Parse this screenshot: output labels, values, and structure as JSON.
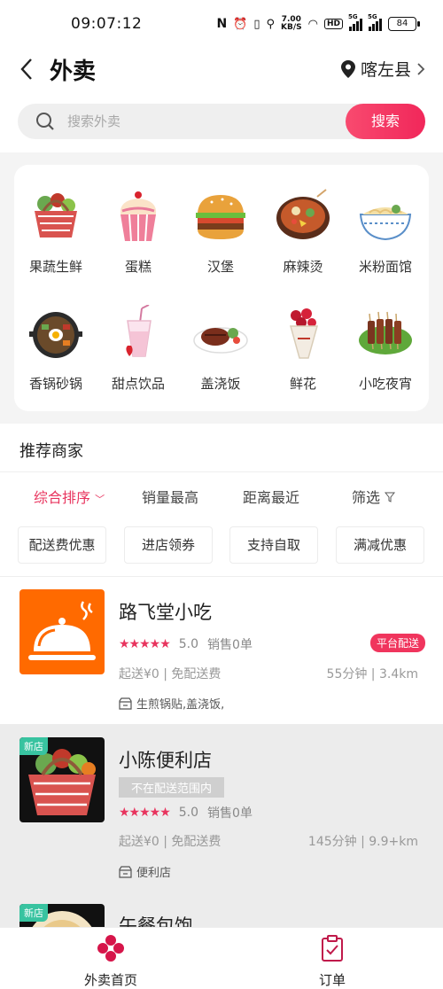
{
  "status_bar": {
    "time": "09:07:12",
    "speed": "7.00",
    "speed_unit": "KB/S",
    "hd": "HD",
    "net1": "5G",
    "net2": "5G",
    "battery": "84"
  },
  "header": {
    "title": "外卖",
    "location": "喀左县"
  },
  "search": {
    "placeholder": "搜索外卖",
    "button": "搜索"
  },
  "categories": [
    {
      "label": "果蔬生鲜",
      "icon": "vegetable-basket-icon"
    },
    {
      "label": "蛋糕",
      "icon": "cupcake-icon"
    },
    {
      "label": "汉堡",
      "icon": "burger-icon"
    },
    {
      "label": "麻辣烫",
      "icon": "hotpot-icon"
    },
    {
      "label": "米粉面馆",
      "icon": "noodle-bowl-icon"
    },
    {
      "label": "香锅砂锅",
      "icon": "bibimbap-pot-icon"
    },
    {
      "label": "甜点饮品",
      "icon": "milkshake-icon"
    },
    {
      "label": "盖浇饭",
      "icon": "steak-plate-icon"
    },
    {
      "label": "鲜花",
      "icon": "flower-bouquet-icon"
    },
    {
      "label": "小吃夜宵",
      "icon": "skewers-icon"
    }
  ],
  "recommend": {
    "title": "推荐商家",
    "sort_options": [
      "综合排序",
      "销量最高",
      "距离最近",
      "筛选"
    ],
    "filters": [
      "配送费优惠",
      "进店领券",
      "支持自取",
      "满减优惠"
    ]
  },
  "stores": [
    {
      "name": "路飞堂小吃",
      "rating": "5.0",
      "sales": "销售0单",
      "delivery_badge": "平台配送",
      "fee": "起送¥0 | 免配送费",
      "eta": "55分钟 | 3.4km",
      "category": "生煎锅贴,盖浇饭,"
    },
    {
      "name": "小陈便利店",
      "new_badge": "新店",
      "notice": "不在配送范围内",
      "rating": "5.0",
      "sales": "销售0单",
      "fee": "起送¥0 | 免配送费",
      "eta": "145分钟 | 9.9+km",
      "category": "便利店"
    },
    {
      "name": "午餐包饱",
      "new_badge": "新店"
    }
  ],
  "bottom_nav": [
    {
      "label": "外卖首页",
      "icon": "takeout-home-icon"
    },
    {
      "label": "订单",
      "icon": "order-clipboard-icon"
    }
  ],
  "colors": {
    "accent": "#e8345e",
    "new_badge": "#38c3a0",
    "logo_orange": "#ff6a00"
  }
}
